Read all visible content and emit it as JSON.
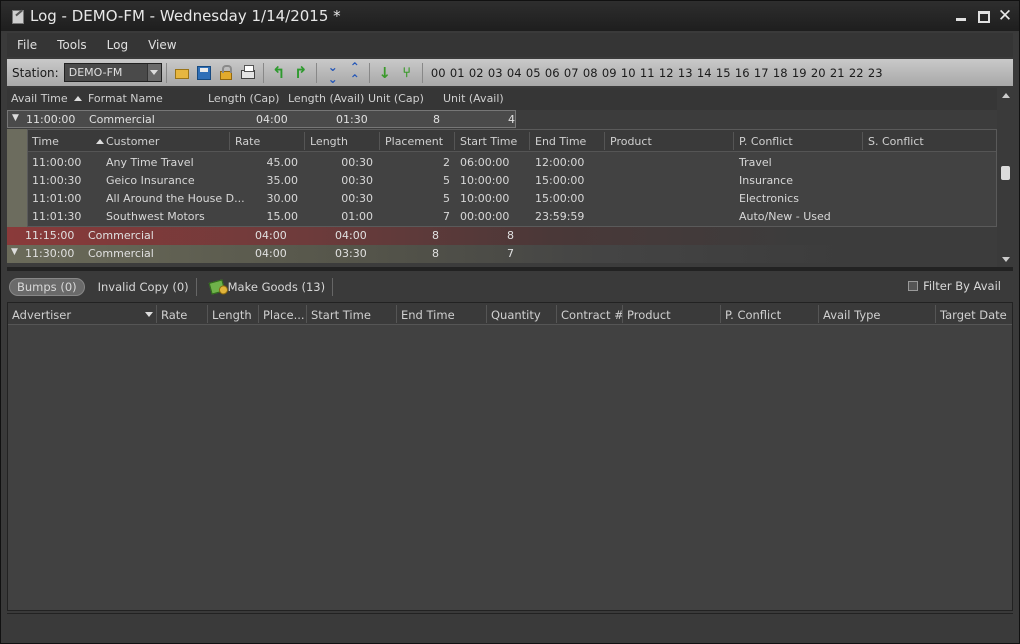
{
  "window": {
    "title": "Log - DEMO-FM - Wednesday 1/14/2015 *"
  },
  "menu": [
    "File",
    "Tools",
    "Log",
    "View"
  ],
  "toolbar": {
    "station_label": "Station:",
    "station_value": "DEMO-FM",
    "hours": [
      "00",
      "01",
      "02",
      "03",
      "04",
      "05",
      "06",
      "07",
      "08",
      "09",
      "10",
      "11",
      "12",
      "13",
      "14",
      "15",
      "16",
      "17",
      "18",
      "19",
      "20",
      "21",
      "22",
      "23"
    ]
  },
  "avail_grid": {
    "columns": [
      "Avail Time",
      "Format Name",
      "Length (Cap)",
      "Length (Avail)",
      "Unit (Cap)",
      "Unit (Avail)"
    ],
    "rows": [
      {
        "time": "11:00:00",
        "format": "Commercial",
        "len_cap": "04:00",
        "len_avail": "01:30",
        "unit_cap": "8",
        "unit_avail": "4"
      },
      {
        "time": "11:15:00",
        "format": "Commercial",
        "len_cap": "04:00",
        "len_avail": "04:00",
        "unit_cap": "8",
        "unit_avail": "8"
      },
      {
        "time": "11:30:00",
        "format": "Commercial",
        "len_cap": "04:00",
        "len_avail": "03:30",
        "unit_cap": "8",
        "unit_avail": "7"
      }
    ]
  },
  "spot_grid": {
    "columns": [
      "Time",
      "Customer",
      "Rate",
      "Length",
      "Placement",
      "Start Time",
      "End Time",
      "Product",
      "P. Conflict",
      "S. Conflict"
    ],
    "rows": [
      {
        "time": "11:00:00",
        "customer": "Any Time Travel",
        "rate": "45.00",
        "length": "00:30",
        "placement": "2",
        "start": "06:00:00",
        "end": "12:00:00",
        "product": "",
        "pconf": "Travel",
        "sconf": ""
      },
      {
        "time": "11:00:30",
        "customer": "Geico Insurance",
        "rate": "35.00",
        "length": "00:30",
        "placement": "5",
        "start": "10:00:00",
        "end": "15:00:00",
        "product": "",
        "pconf": "Insurance",
        "sconf": ""
      },
      {
        "time": "11:01:00",
        "customer": "All Around the House D...",
        "rate": "30.00",
        "length": "00:30",
        "placement": "5",
        "start": "10:00:00",
        "end": "15:00:00",
        "product": "",
        "pconf": "Electronics",
        "sconf": ""
      },
      {
        "time": "11:01:30",
        "customer": "Southwest Motors",
        "rate": "15.00",
        "length": "01:00",
        "placement": "7",
        "start": "00:00:00",
        "end": "23:59:59",
        "product": "",
        "pconf": "Auto/New - Used",
        "sconf": ""
      }
    ]
  },
  "tabs": [
    "Bumps (0)",
    "Invalid Copy (0)",
    "Make Goods (13)"
  ],
  "filter_label": "Filter By Avail",
  "bottom_grid": {
    "columns": [
      "Advertiser",
      "Rate",
      "Length",
      "Place...",
      "Start Time",
      "End Time",
      "Quantity",
      "Contract #",
      "Product",
      "P. Conflict",
      "Avail Type",
      "Target Date"
    ]
  }
}
